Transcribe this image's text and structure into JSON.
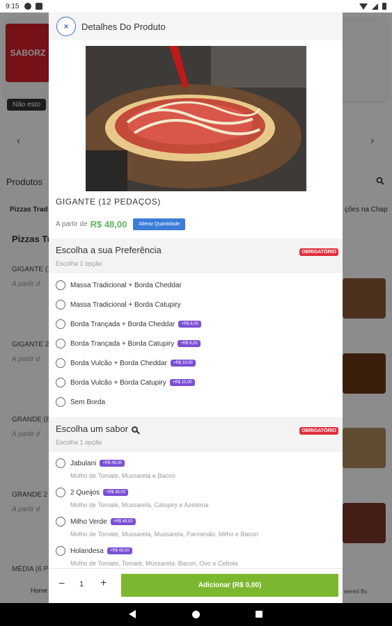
{
  "status_bar": {
    "time": "9:15"
  },
  "background": {
    "logo_text": "SABORZ",
    "closed_badge": "Não esto",
    "products_title": "Produtos",
    "tab_left": "Pizzas Trad",
    "tab_right": "ções na Chap",
    "section_title": "Pizzas Tr",
    "items": [
      {
        "name": "GIGANTE (1",
        "price_hint": "A partir d"
      },
      {
        "name": "GIGANTE 2",
        "price_hint": "A partir d"
      },
      {
        "name": "GRANDE (8",
        "price_hint": "A partir d"
      },
      {
        "name": "GRANDE 2",
        "price_hint": "A partir d"
      },
      {
        "name": "MÉDIA (6 P",
        "price_hint": ""
      }
    ],
    "nav_home_label": "Home",
    "powered_label": "wered By"
  },
  "modal": {
    "title": "Detalhes Do Produto",
    "close_icon": "×",
    "product_name": "GIGANTE (12 PEDAÇOS)",
    "price_label": "A partir de",
    "price_value": "R$ 48,00",
    "change_qty_label": "Alterar Quantidade",
    "groups": [
      {
        "title": "Escolha a sua Preferência",
        "subtitle": "Escolha 1 opção",
        "badge": "OBRIGATÓRIO",
        "options": [
          {
            "label": "Massa Tradicional + Borda Cheddar",
            "price": ""
          },
          {
            "label": "Massa Tradicional + Borda Catupiry",
            "price": ""
          },
          {
            "label": "Borda Trançada + Borda Cheddar",
            "price": "+R$ 8,00"
          },
          {
            "label": "Borda Trançada + Borda Catupiry",
            "price": "+R$ 8,00"
          },
          {
            "label": "Borda Vulcão + Borda Cheddar",
            "price": "+R$ 10,00"
          },
          {
            "label": "Borda Vulcão + Borda Catupiry",
            "price": "+R$ 10,00"
          },
          {
            "label": "Sem Borda",
            "price": ""
          }
        ]
      },
      {
        "title": "Escolha um sabor",
        "subtitle": "Escolha 1 opção",
        "badge": "OBRIGATÓRIO",
        "options": [
          {
            "label": "Jabulani",
            "price": "+R$ 48,00",
            "desc": "Molho de Tomate, Mussarela e Bacon"
          },
          {
            "label": "2 Queijos",
            "price": "+R$ 48,00",
            "desc": "Molho de Tomate, Mussarela, Catupiry e Azeitona"
          },
          {
            "label": "Milho Verde",
            "price": "+R$ 48,00",
            "desc": "Molho de Tomate, Mussarela, Mussarela, Parmesão, Milho e Bacon"
          },
          {
            "label": "Holandesa",
            "price": "+R$ 48,00",
            "desc": "Molho de Tomate, Tomate, Mussarela, Bacon, Ovo e Cebola"
          }
        ]
      }
    ],
    "quantity": "1",
    "minus": "−",
    "plus": "+",
    "add_button_label": "Adicionar (R$ 0,00)"
  },
  "colors": {
    "accent_blue": "#3b7dd8",
    "price_green": "#5cb85c",
    "add_green": "#7cb82f",
    "required_red": "#e0303a",
    "price_badge_purple": "#7b4fd6",
    "brand_red": "#d6202a"
  }
}
